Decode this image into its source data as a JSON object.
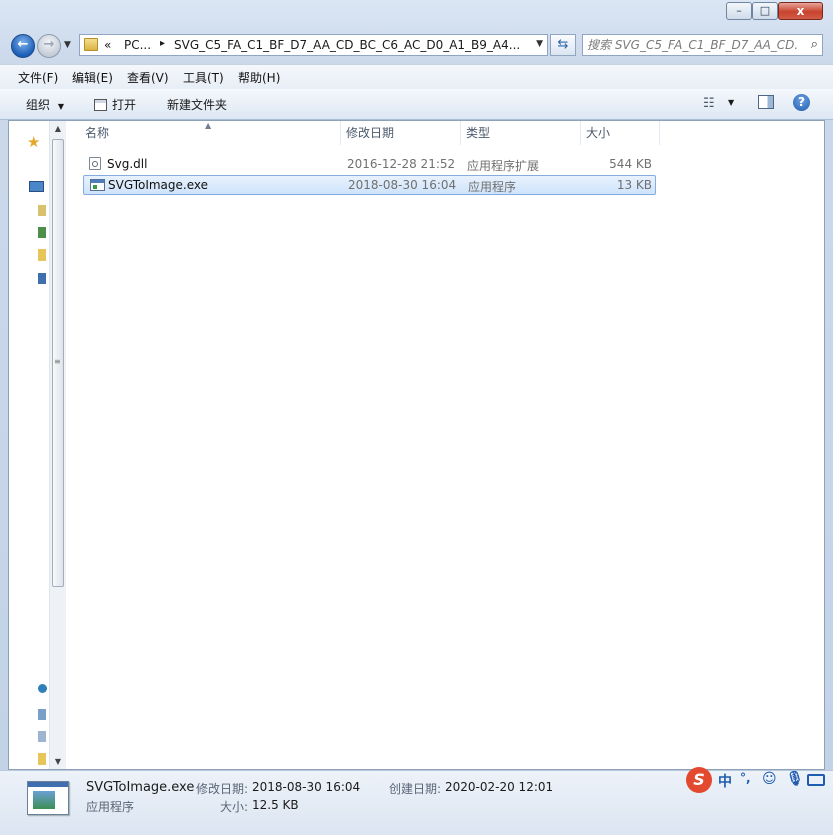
{
  "window": {
    "minimize": "–",
    "maximize": "□",
    "close": "x"
  },
  "nav": {
    "back_icon": "←",
    "forward_icon": "→",
    "address_crumbs": [
      "«",
      "PC...",
      "▸",
      "SVG_C5_FA_C1_BF_D7_AA_CD_BC_C6_AC_D0_A1_B9_A4..."
    ],
    "refresh_icon": "⇆",
    "search_placeholder": "搜索 SVG_C5_FA_C1_BF_D7_AA_CD..."
  },
  "menu": [
    "文件(F)",
    "编辑(E)",
    "查看(V)",
    "工具(T)",
    "帮助(H)"
  ],
  "toolbar": {
    "organize": "组织",
    "open": "打开",
    "new_folder": "新建文件夹"
  },
  "columns": {
    "name": "名称",
    "modified": "修改日期",
    "type": "类型",
    "size": "大小"
  },
  "files": [
    {
      "name": "Svg.dll",
      "modified": "2016-12-28 21:52",
      "type": "应用程序扩展",
      "size": "544 KB",
      "icon": "dll-file-icon",
      "selected": false
    },
    {
      "name": "SVGToImage.exe",
      "modified": "2018-08-30 16:04",
      "type": "应用程序",
      "size": "13 KB",
      "icon": "exe-file-icon",
      "selected": true
    }
  ],
  "details": {
    "name": "SVGToImage.exe",
    "type": "应用程序",
    "modified_label": "修改日期:",
    "modified_value": "2018-08-30 16:04",
    "size_label": "大小:",
    "size_value": "12.5 KB",
    "created_label": "创建日期:",
    "created_value": "2020-02-20 12:01"
  },
  "ime": {
    "logo": "S",
    "lang": "中",
    "punct": "°,",
    "emoji": "☺"
  }
}
